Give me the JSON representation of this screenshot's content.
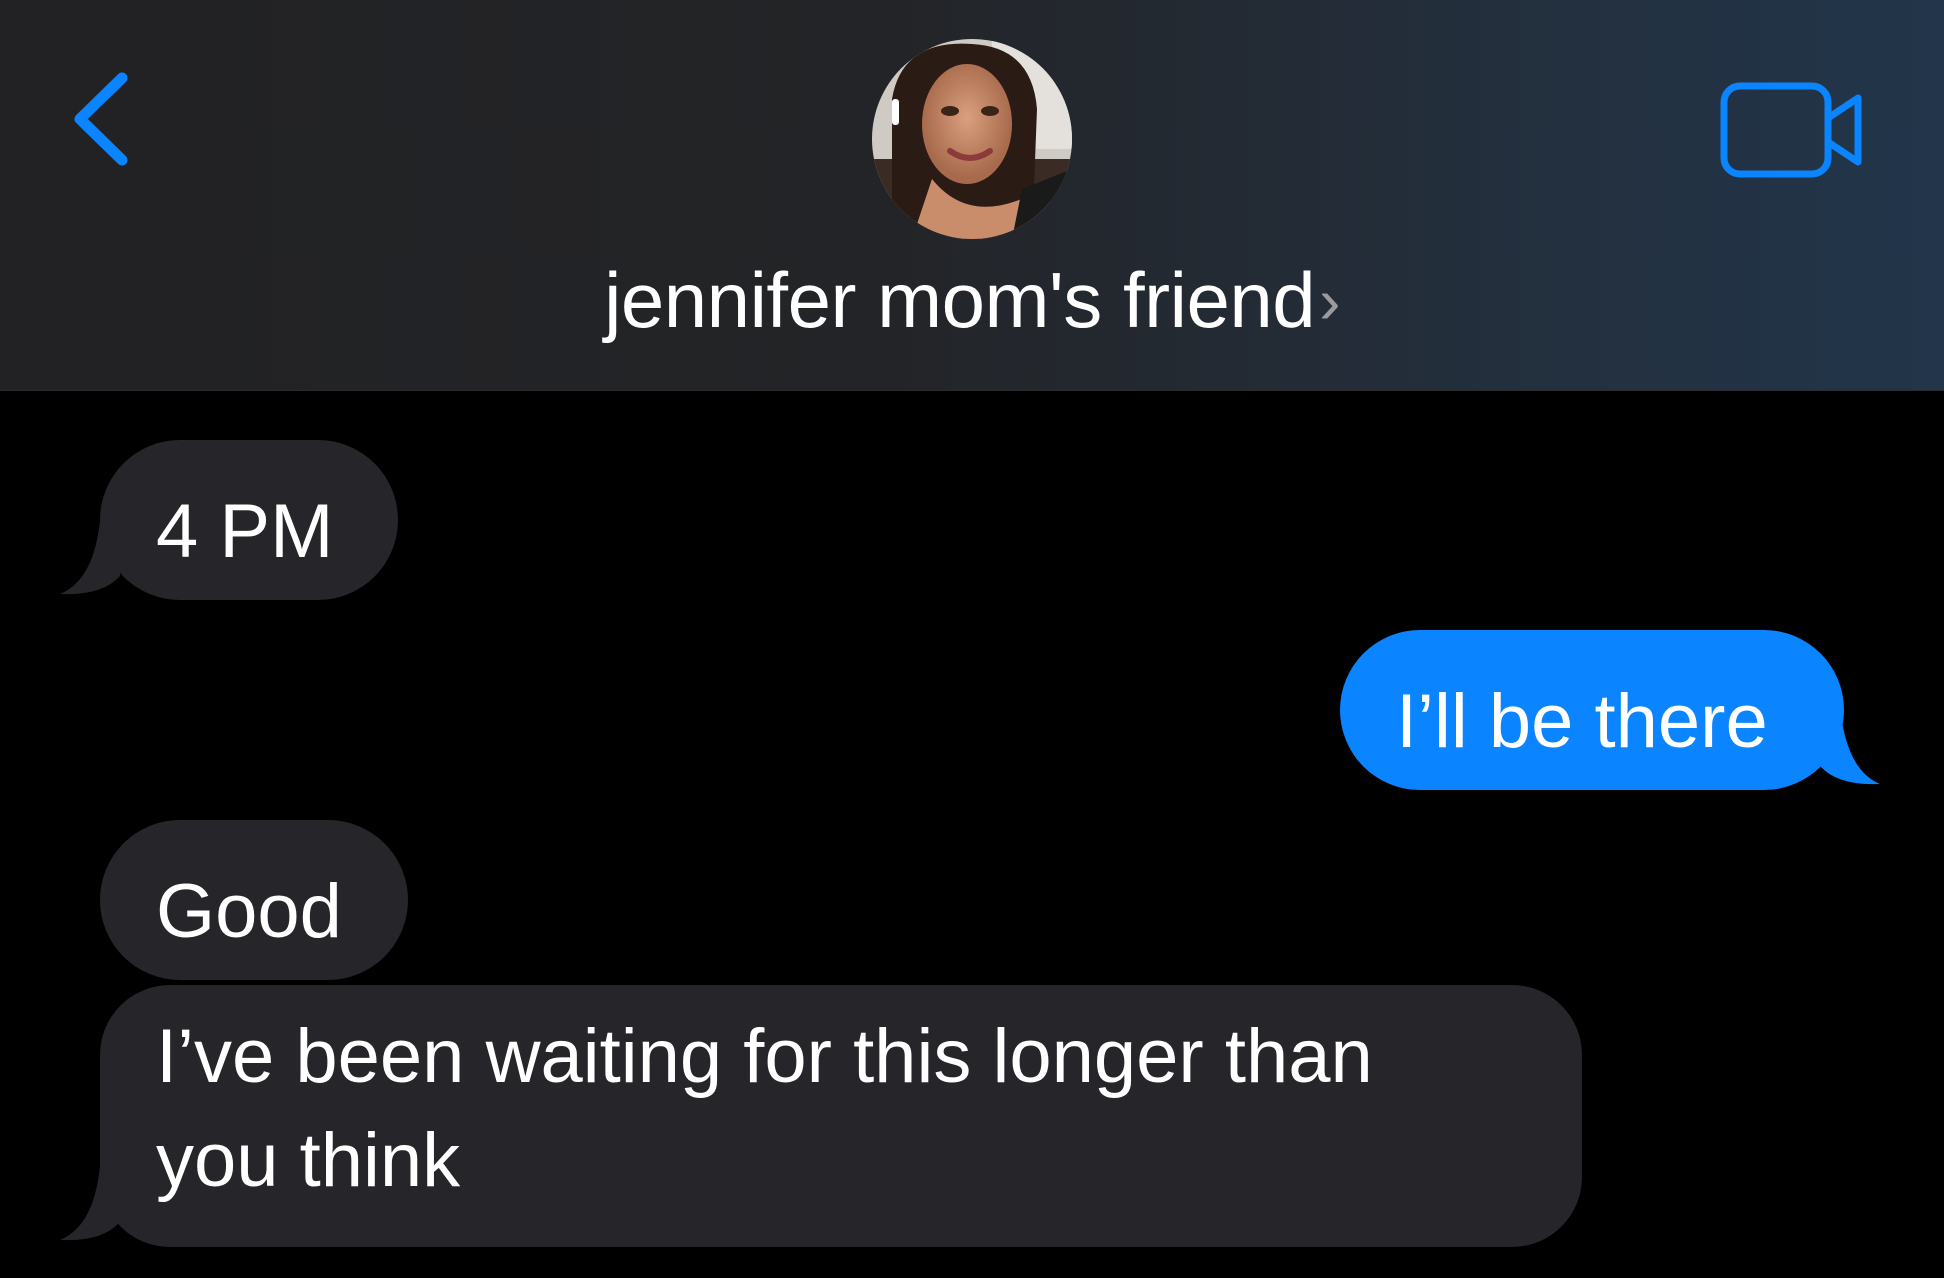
{
  "header": {
    "back_icon": "chevron-left-icon",
    "contact_name": "jennifer mom's friend",
    "name_chevron": "›",
    "video_icon": "video-camera-icon"
  },
  "colors": {
    "accent": "#0a84ff",
    "incoming_bubble": "#26252a",
    "outgoing_bubble": "#0a84ff",
    "background": "#000000"
  },
  "messages": [
    {
      "direction": "incoming",
      "text": "4 PM"
    },
    {
      "direction": "outgoing",
      "text": "I’ll be there"
    },
    {
      "direction": "incoming",
      "text": "Good"
    },
    {
      "direction": "incoming",
      "lines": [
        "I’ve been waiting for this longer than",
        "you think"
      ]
    }
  ]
}
